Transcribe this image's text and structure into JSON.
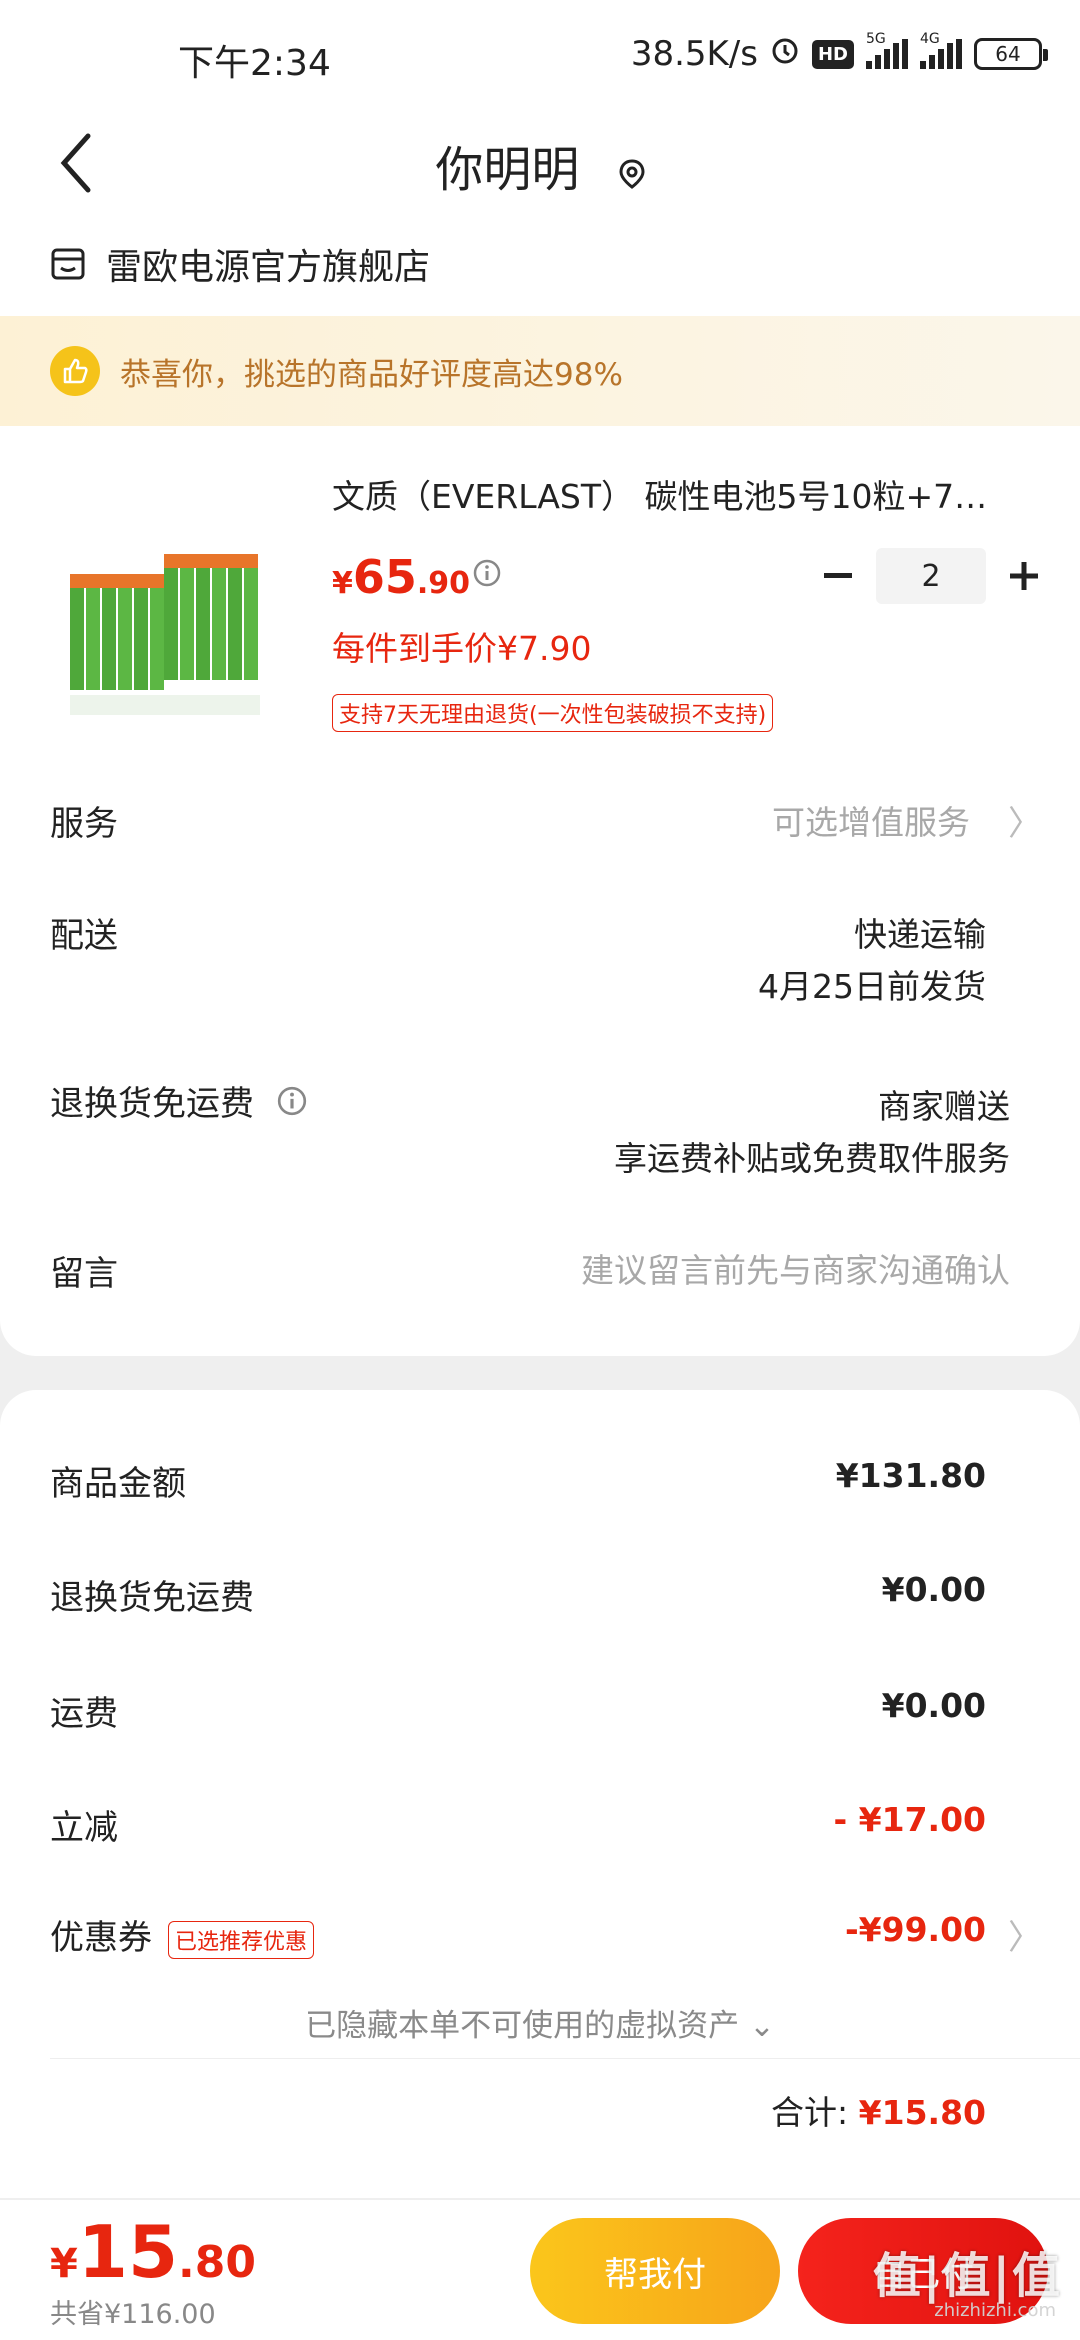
{
  "status_bar": {
    "time": "下午2:34",
    "net_speed": "38.5K/s",
    "hd": "HD",
    "sig1_label": "5G",
    "sig2_label": "4G",
    "battery": "64"
  },
  "header": {
    "title": "你明明"
  },
  "store": {
    "name": "雷欧电源官方旗舰店"
  },
  "banner": {
    "text": "恭喜你，挑选的商品好评度高达98%"
  },
  "product": {
    "name": "文质（EVERLAST） 碳性电池5号10粒+7…",
    "price_symbol": "¥",
    "price_int": "65",
    "price_dec": ".90",
    "quantity": "2",
    "unit_price": "每件到手价¥7.90",
    "return_policy": "支持7天无理由退货(一次性包装破损不支持)"
  },
  "rows": {
    "service_label": "服务",
    "service_value": "可选增值服务",
    "delivery_label": "配送",
    "delivery_method": "快递运输",
    "delivery_date": "4月25日前发货",
    "return_freight_label": "退换货免运费",
    "return_freight_value1": "商家赠送",
    "return_freight_value2": "享运费补贴或免费取件服务",
    "message_label": "留言",
    "message_placeholder": "建议留言前先与商家沟通确认"
  },
  "summary": {
    "goods_amount_label": "商品金额",
    "goods_amount": "¥131.80",
    "return_freight_label": "退换货免运费",
    "return_freight": "¥0.00",
    "shipping_label": "运费",
    "shipping": "¥0.00",
    "discount_label": "立减",
    "discount": "- ¥17.00",
    "coupon_label": "优惠券",
    "coupon_tag": "已选推荐优惠",
    "coupon": "-¥99.00",
    "hidden_assets": "已隐藏本单不可使用的虚拟资产",
    "total_label": "合计:",
    "total": "¥15.80"
  },
  "bottom": {
    "price_symbol": "¥",
    "price_int": "15",
    "price_dec": ".80",
    "saved": "共省¥116.00",
    "help_pay": "帮我付",
    "self_pay": "自己付",
    "watermark": "值|值|值",
    "watermark_site": "zhizhizhi.com"
  },
  "colors": {
    "accent_red": "#e7260f",
    "banner_text": "#b8742a",
    "help_btn": "#f7a41a"
  }
}
